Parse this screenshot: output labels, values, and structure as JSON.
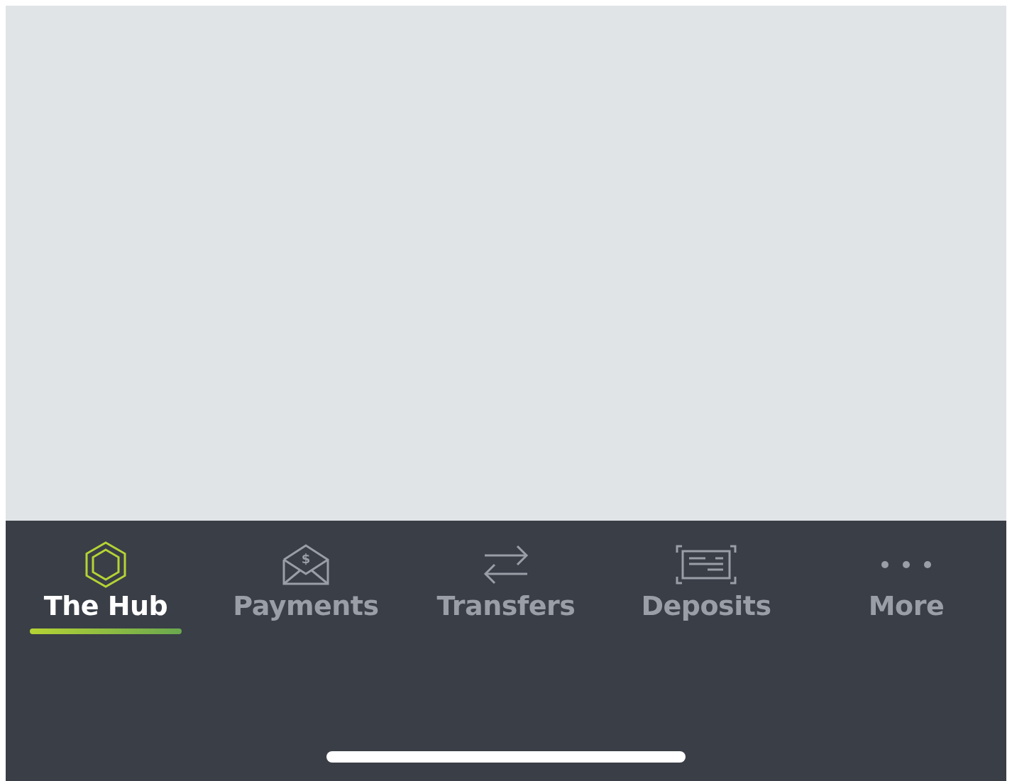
{
  "tabs": [
    {
      "label": "The Hub",
      "kind": "hub",
      "selected": true
    },
    {
      "label": "Payments",
      "kind": "payments",
      "glyph": "$",
      "selected": false
    },
    {
      "label": "Transfers",
      "kind": "transfers",
      "selected": false
    },
    {
      "label": "Deposits",
      "kind": "deposits",
      "selected": false
    },
    {
      "label": "More",
      "kind": "more",
      "selected": false
    }
  ]
}
